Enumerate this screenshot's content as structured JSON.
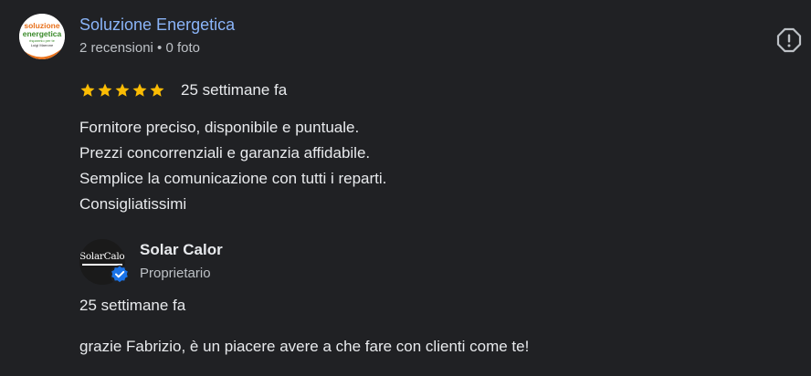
{
  "reviewer": {
    "name": "Soluzione Energetica",
    "meta": "2 recensioni • 0 foto",
    "avatar_logo_lines": [
      "soluzione",
      "energetica",
      "risparmio per te",
      "Luigi Marrone"
    ]
  },
  "review": {
    "stars": 5,
    "date": "25 settimane fa",
    "lines": [
      "Fornitore preciso, disponibile e puntuale.",
      "Prezzi concorrenziali e garanzia affidabile.",
      "Semplice la comunicazione con tutti i reparti.",
      "Consigliatissimi"
    ]
  },
  "owner_response": {
    "name": "Solar Calor",
    "role": "Proprietario",
    "avatar_text": "SolarCalor",
    "date": "25 settimane fa",
    "text": "grazie Fabrizio, è un piacere avere a che fare con clienti come te!"
  },
  "icons": {
    "report": "report-icon",
    "star": "star-icon",
    "verified": "verified-badge-icon"
  },
  "colors": {
    "background": "#202124",
    "reviewer_name": "#8ab4f8",
    "star": "#fbbc04",
    "verified": "#1a73e8"
  }
}
